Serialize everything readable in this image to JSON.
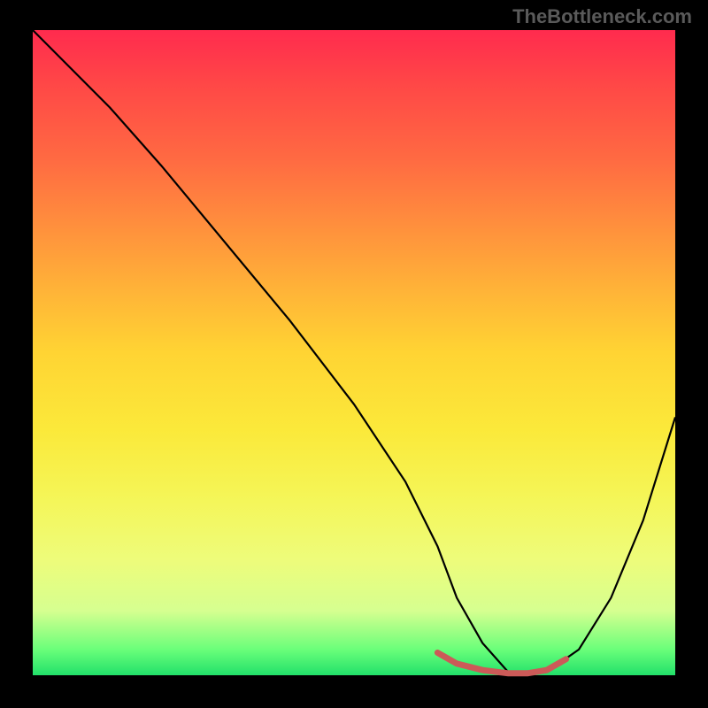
{
  "watermark": "TheBottleneck.com",
  "chart_data": {
    "type": "line",
    "title": "",
    "xlabel": "",
    "ylabel": "",
    "xlim": [
      0,
      100
    ],
    "ylim": [
      0,
      100
    ],
    "series": [
      {
        "name": "bottleneck-curve",
        "x": [
          0,
          6,
          12,
          20,
          30,
          40,
          50,
          58,
          63,
          66,
          70,
          74,
          77,
          80,
          85,
          90,
          95,
          100
        ],
        "y": [
          100,
          94,
          88,
          79,
          67,
          55,
          42,
          30,
          20,
          12,
          5,
          0.5,
          0,
          0.5,
          4,
          12,
          24,
          40
        ],
        "color": "#000000"
      },
      {
        "name": "low-band",
        "x": [
          63,
          66,
          70,
          74,
          77,
          80,
          83
        ],
        "y": [
          3.5,
          1.8,
          0.8,
          0.3,
          0.3,
          0.8,
          2.5
        ],
        "color": "#cc5a58"
      }
    ],
    "gradient_stops": [
      {
        "pos": 0,
        "color": "#ff2b4e"
      },
      {
        "pos": 50,
        "color": "#ffd433"
      },
      {
        "pos": 82,
        "color": "#eefc7a"
      },
      {
        "pos": 100,
        "color": "#22e06a"
      }
    ]
  }
}
